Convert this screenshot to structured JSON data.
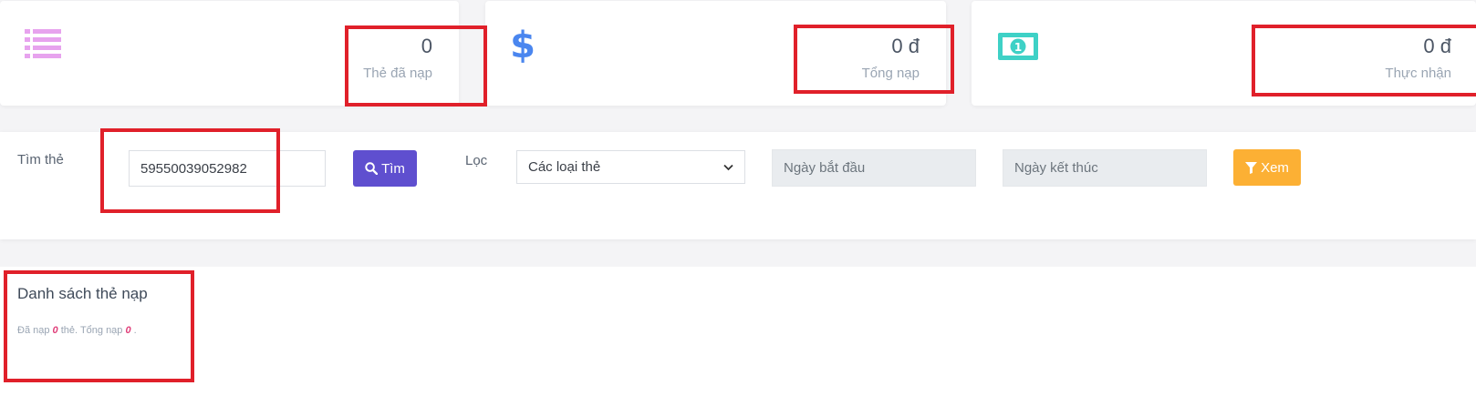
{
  "stats": [
    {
      "value": "0",
      "label": "Thẻ đã nạp",
      "icon": "list-icon",
      "icon_color": "#e7a3ee"
    },
    {
      "value": "0 đ",
      "label": "Tổng nạp",
      "icon": "dollar-icon",
      "icon_color": "#4a86ef"
    },
    {
      "value": "0 đ",
      "label": "Thực nhận",
      "icon": "banknote-icon",
      "icon_color": "#3ed1c6"
    }
  ],
  "search": {
    "label": "Tìm thẻ",
    "value": "59550039052982",
    "button_label": "Tìm"
  },
  "filter": {
    "label": "Lọc",
    "selected_option": "Các loại thẻ",
    "start_date_placeholder": "Ngày bắt đầu",
    "end_date_placeholder": "Ngày kết thúc",
    "view_button_label": "Xem"
  },
  "list": {
    "title": "Danh sách thẻ nạp",
    "summary_prefix": "Đã nạp",
    "summary_count": "0",
    "summary_middle": "thẻ. Tổng nạp",
    "summary_total": "0",
    "summary_suffix": "."
  },
  "colors": {
    "highlight_box": "#e0202a",
    "search_button": "#5f4fcf",
    "view_button": "#fcb034"
  }
}
